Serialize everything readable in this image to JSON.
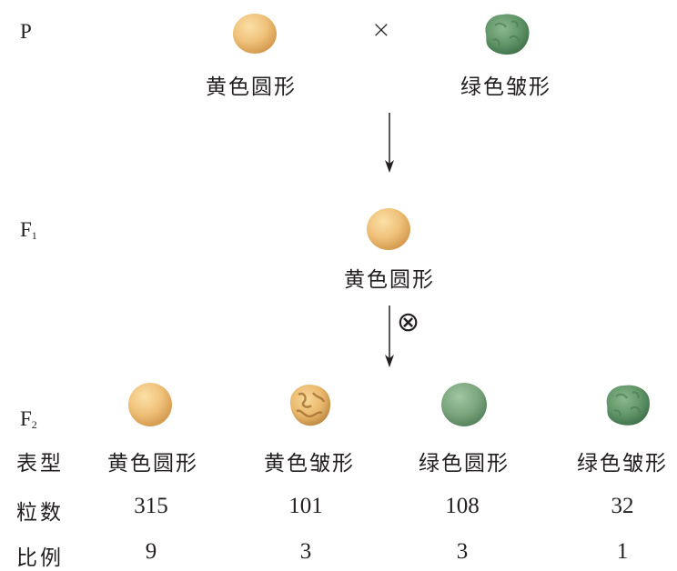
{
  "generations": {
    "p": "P",
    "f1_letter": "F",
    "f1_sub": "1",
    "f2_letter": "F",
    "f2_sub": "2"
  },
  "cross_symbol": "×",
  "self_symbol": "⊗",
  "parents": {
    "left_label": "黄色圆形",
    "right_label": "绿色皱形"
  },
  "f1": {
    "label": "黄色圆形"
  },
  "table": {
    "row_headers": [
      "表型",
      "粒数",
      "比例"
    ],
    "columns": [
      {
        "phenotype": "黄色圆形",
        "count": "315",
        "ratio": "9"
      },
      {
        "phenotype": "黄色皱形",
        "count": "101",
        "ratio": "3"
      },
      {
        "phenotype": "绿色圆形",
        "count": "108",
        "ratio": "3"
      },
      {
        "phenotype": "绿色皱形",
        "count": "32",
        "ratio": "1"
      }
    ]
  },
  "colors": {
    "yellow_pea": "#f0c27b",
    "green_pea": "#7aa57d",
    "wrinkled_green": "#5f9467",
    "wrinkled_yellow": "#e9b76b",
    "text": "#231f20"
  },
  "icons": [
    "yellow-round-pea-icon",
    "green-wrinkled-pea-icon",
    "yellow-wrinkled-pea-icon",
    "green-round-pea-icon"
  ]
}
